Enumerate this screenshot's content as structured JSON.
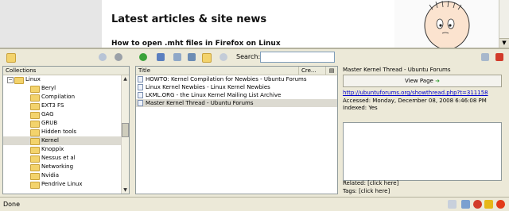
{
  "webpage": {
    "heading": "Latest articles & site news",
    "subheading": "How to open .mht files in Firefox on Linux"
  },
  "toolbar": {
    "search_label": "Search:",
    "search_value": ""
  },
  "collections": {
    "header": "Collections",
    "items": [
      {
        "label": "Linux",
        "root": true
      },
      {
        "label": "Beryl"
      },
      {
        "label": "Compilation"
      },
      {
        "label": "EXT3 FS"
      },
      {
        "label": "GAG"
      },
      {
        "label": "GRUB"
      },
      {
        "label": "Hidden tools"
      },
      {
        "label": "Kernel",
        "selected": true
      },
      {
        "label": "Knoppix"
      },
      {
        "label": "Nessus et al"
      },
      {
        "label": "Networking"
      },
      {
        "label": "Nvidia"
      },
      {
        "label": "Pendrive Linux"
      }
    ]
  },
  "articles": {
    "col_title": "Title",
    "col_created": "Cre...",
    "rows": [
      {
        "title": "HOWTO: Kernel Compilation for Newbies - Ubuntu Forums"
      },
      {
        "title": "Linux Kernel Newbies - Linux Kernel Newbies"
      },
      {
        "title": "LKML.ORG - the Linux Kernel Mailing List Archive"
      },
      {
        "title": "Master Kernel Thread - Ubuntu Forums",
        "selected": true
      }
    ]
  },
  "detail": {
    "title": "Master Kernel Thread - Ubuntu Forums",
    "view_button": "View Page",
    "url": "http://ubuntuforums.org/showthread.php?t=311158",
    "accessed": "Accessed: Monday, December 08, 2008 6:46:08 PM",
    "indexed": "Indexed: Yes",
    "related": "Related: [click here]",
    "tags": "Tags: [click here]"
  },
  "status": {
    "text": "Done"
  },
  "colors": {
    "selection": "#dcdad1",
    "link": "#0000cc",
    "chrome": "#ece9d8"
  }
}
